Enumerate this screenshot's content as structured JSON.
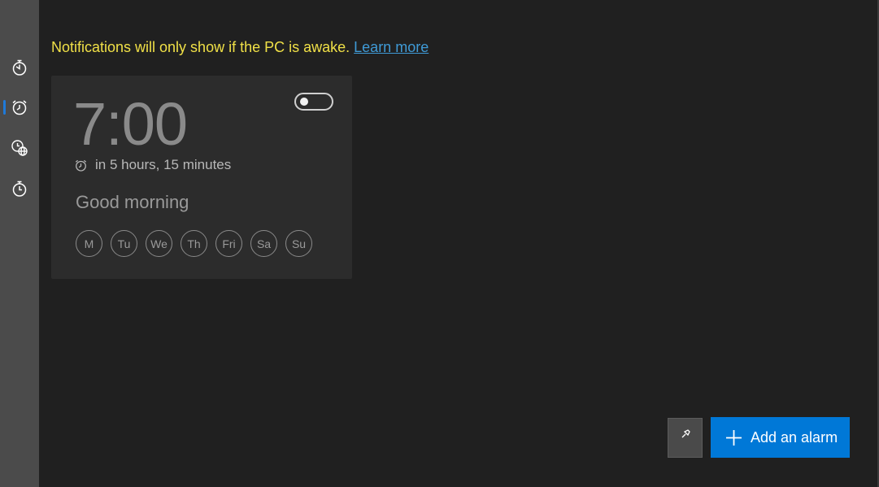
{
  "nav": {
    "items": [
      {
        "icon": "timer-icon",
        "selected": false
      },
      {
        "icon": "alarm-clock-icon",
        "selected": true
      },
      {
        "icon": "world-clock-icon",
        "selected": false
      },
      {
        "icon": "stopwatch-icon",
        "selected": false
      }
    ]
  },
  "notice": {
    "text": "Notifications will only show if the PC is awake.",
    "link": "Learn more"
  },
  "alarm": {
    "time": "7:00",
    "eta": "in 5 hours, 15 minutes",
    "name": "Good morning",
    "enabled": false,
    "days": [
      "M",
      "Tu",
      "We",
      "Th",
      "Fri",
      "Sa",
      "Su"
    ]
  },
  "actions": {
    "pin_icon": "pin-icon",
    "add_label": "Add an alarm"
  },
  "colors": {
    "background": "#202020",
    "nav_rail": "#4b4b4b",
    "accent": "#0078d7",
    "notice_text": "#f0e047",
    "link": "#3f9ad6"
  }
}
